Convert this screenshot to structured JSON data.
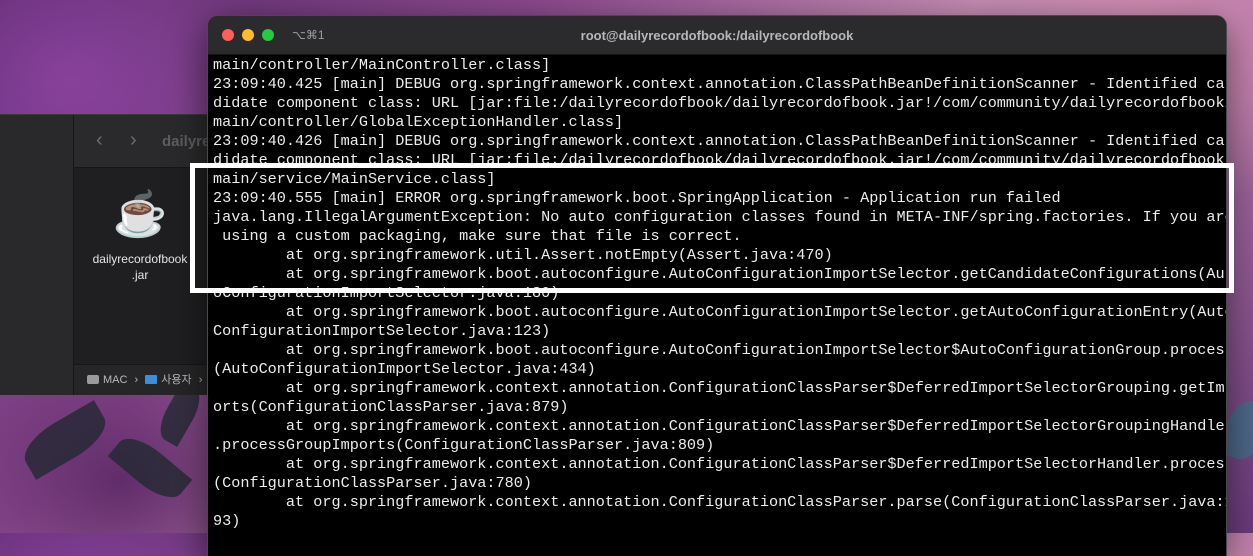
{
  "finder": {
    "folder_title": "dailyre",
    "back_arrow": "‹",
    "forward_arrow": "›",
    "file": {
      "icon": "java-cup-icon",
      "label_line1": "dailyrecordofbook",
      "label_line2": ".jar"
    },
    "statusbar": {
      "disk_label": "MAC",
      "separator": "›",
      "folder_label": "사용자",
      "separator2": "›"
    }
  },
  "terminal": {
    "shortcut": "⌥⌘1",
    "title": "root@dailyrecordofbook:/dailyrecordofbook",
    "lines": [
      "main/controller/MainController.class]",
      "23:09:40.425 [main] DEBUG org.springframework.context.annotation.ClassPathBeanDefinitionScanner - Identified can",
      "didate component class: URL [jar:file:/dailyrecordofbook/dailyrecordofbook.jar!/com/community/dailyrecordofbook/",
      "main/controller/GlobalExceptionHandler.class]",
      "23:09:40.426 [main] DEBUG org.springframework.context.annotation.ClassPathBeanDefinitionScanner - Identified can",
      "didate component class: URL [jar:file:/dailyrecordofbook/dailyrecordofbook.jar!/com/community/dailyrecordofbook/",
      "main/service/MainService.class]",
      "23:09:40.555 [main] ERROR org.springframework.boot.SpringApplication - Application run failed",
      "java.lang.IllegalArgumentException: No auto configuration classes found in META-INF/spring.factories. If you are",
      " using a custom packaging, make sure that file is correct.",
      "        at org.springframework.util.Assert.notEmpty(Assert.java:470)",
      "        at org.springframework.boot.autoconfigure.AutoConfigurationImportSelector.getCandidateConfigurations(Aut",
      "oConfigurationImportSelector.java:180)",
      "        at org.springframework.boot.autoconfigure.AutoConfigurationImportSelector.getAutoConfigurationEntry(Auto",
      "ConfigurationImportSelector.java:123)",
      "        at org.springframework.boot.autoconfigure.AutoConfigurationImportSelector$AutoConfigurationGroup.process",
      "(AutoConfigurationImportSelector.java:434)",
      "        at org.springframework.context.annotation.ConfigurationClassParser$DeferredImportSelectorGrouping.getImp",
      "orts(ConfigurationClassParser.java:879)",
      "        at org.springframework.context.annotation.ConfigurationClassParser$DeferredImportSelectorGroupingHandler",
      ".processGroupImports(ConfigurationClassParser.java:809)",
      "        at org.springframework.context.annotation.ConfigurationClassParser$DeferredImportSelectorHandler.process",
      "(ConfigurationClassParser.java:780)",
      "        at org.springframework.context.annotation.ConfigurationClassParser.parse(ConfigurationClassParser.java:1",
      "93)"
    ]
  },
  "colors": {
    "traffic_red": "#ff5f57",
    "traffic_yellow": "#febc2e",
    "traffic_green": "#28c840",
    "highlight_border": "#ffffff"
  }
}
